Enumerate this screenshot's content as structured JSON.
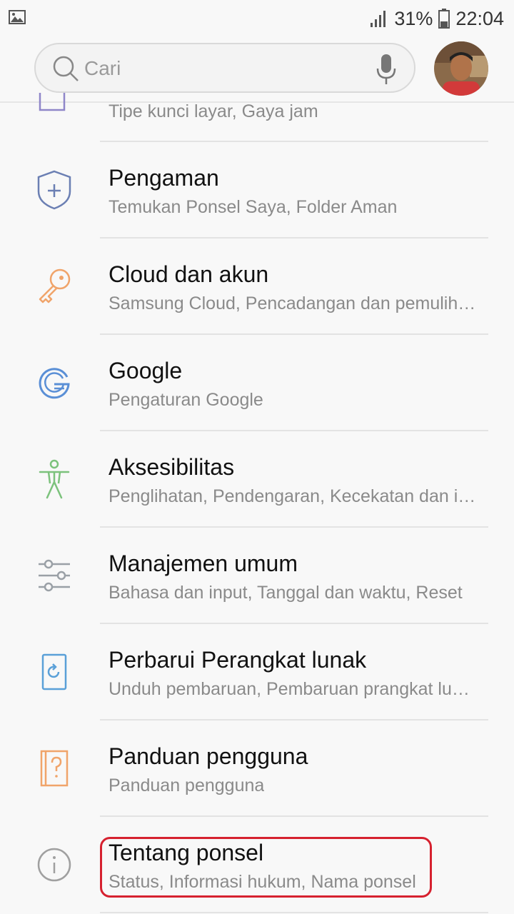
{
  "status_bar": {
    "battery_percent": "31%",
    "time": "22:04"
  },
  "search": {
    "placeholder": "Cari"
  },
  "partial_item": {
    "subtitle": "Tipe kunci layar, Gaya jam"
  },
  "settings_items": [
    {
      "title": "Pengaman",
      "subtitle": "Temukan Ponsel Saya, Folder Aman",
      "icon": "shield-icon",
      "color": "#6b7fb3"
    },
    {
      "title": "Cloud dan akun",
      "subtitle": "Samsung Cloud, Pencadangan dan pemulih…",
      "icon": "key-icon",
      "color": "#f0a46a"
    },
    {
      "title": "Google",
      "subtitle": "Pengaturan Google",
      "icon": "google-icon",
      "color": "#5a8fd6"
    },
    {
      "title": "Aksesibilitas",
      "subtitle": "Penglihatan, Pendengaran, Kecekatan dan i…",
      "icon": "accessibility-icon",
      "color": "#7cc27c"
    },
    {
      "title": "Manajemen umum",
      "subtitle": "Bahasa dan input, Tanggal dan waktu, Reset",
      "icon": "sliders-icon",
      "color": "#9aa0a6"
    },
    {
      "title": "Perbarui Perangkat lunak",
      "subtitle": "Unduh pembaruan, Pembaruan prangkat lu…",
      "icon": "software-update-icon",
      "color": "#5aa0d8"
    },
    {
      "title": "Panduan pengguna",
      "subtitle": "Panduan pengguna",
      "icon": "user-manual-icon",
      "color": "#f0a46a"
    },
    {
      "title": "Tentang ponsel",
      "subtitle": "Status, Informasi hukum, Nama ponsel",
      "icon": "info-icon",
      "color": "#a0a0a0"
    }
  ],
  "highlight_color": "#d6212f"
}
